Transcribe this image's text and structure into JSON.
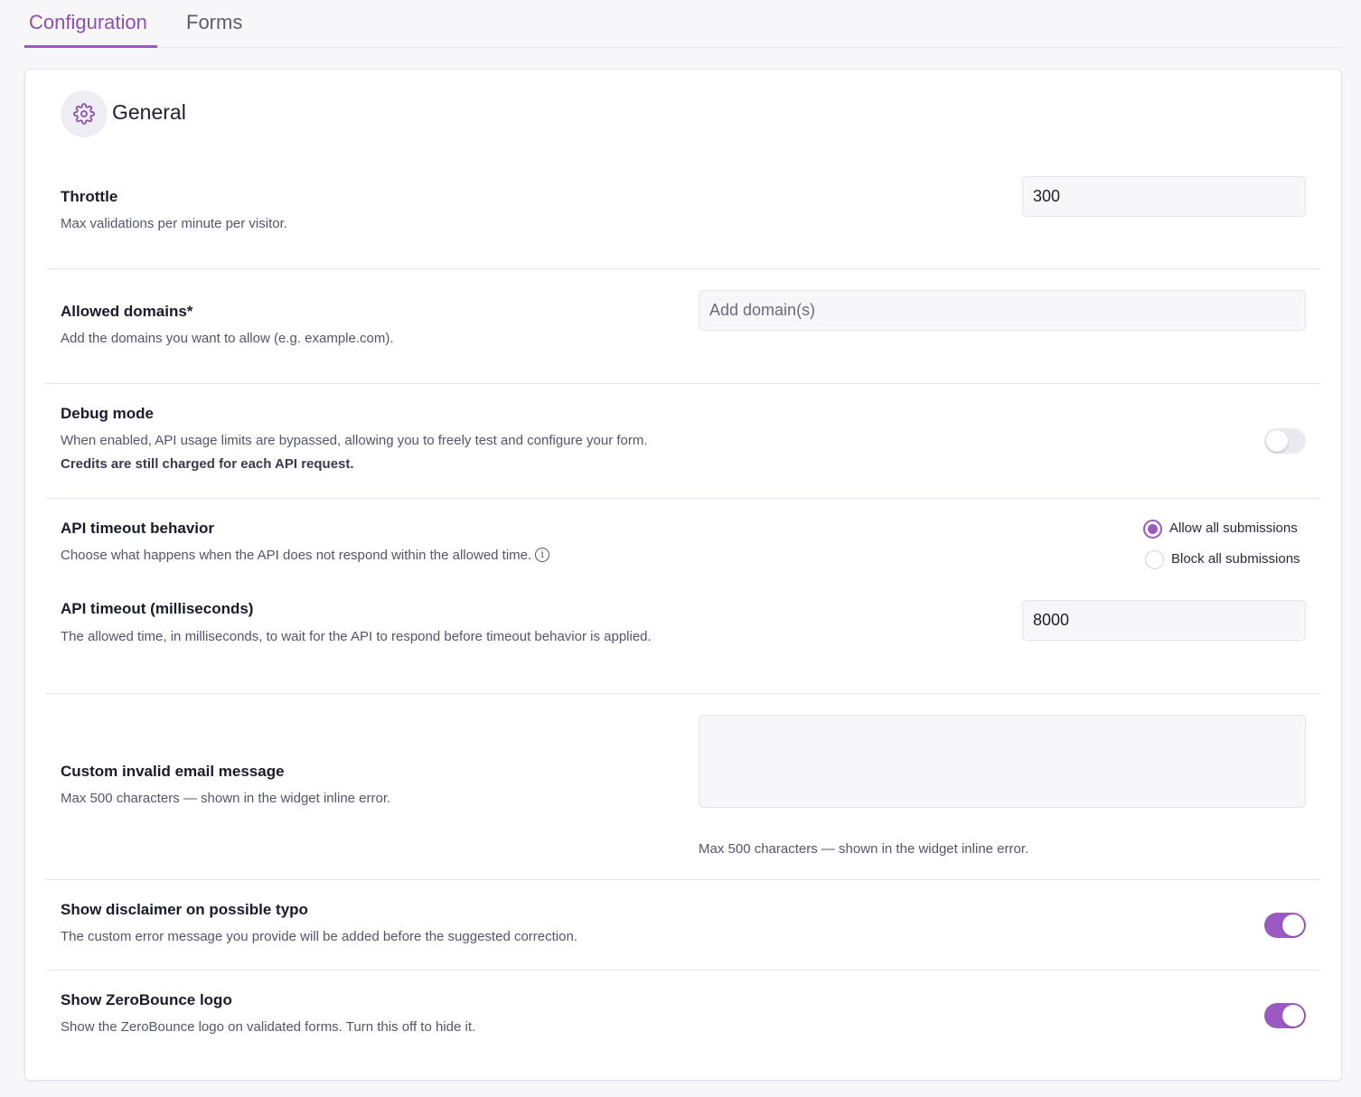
{
  "tabs": [
    {
      "label": "Configuration",
      "active": true
    },
    {
      "label": "Forms",
      "active": false
    }
  ],
  "accent_color": "#9b5ac2",
  "section": {
    "title": "General",
    "icon": "gear-icon"
  },
  "throttle": {
    "label": "Throttle",
    "description": "Max validations per minute per visitor.",
    "value": "300"
  },
  "allowed_domains": {
    "label": "Allowed domains*",
    "description": "Add the domains you want to allow (e.g. example.com).",
    "placeholder": "Add domain(s)",
    "value": ""
  },
  "debug_mode": {
    "label": "Debug mode",
    "description": "When enabled, API usage limits are bypassed, allowing you to freely test and configure your form.",
    "description_bold": "Credits are still charged for each API request.",
    "enabled": false
  },
  "api_timeout_behavior": {
    "label": "API timeout behavior",
    "description": "Choose what happens when the API does not respond within the allowed time.",
    "info_icon": "info-icon",
    "options": [
      {
        "label": "Allow all submissions",
        "selected": true
      },
      {
        "label": "Block all submissions",
        "selected": false
      }
    ]
  },
  "api_timeout": {
    "label": "API timeout (milliseconds)",
    "description": "The allowed time, in milliseconds, to wait for the API to respond before timeout behavior is applied.",
    "value": "8000"
  },
  "custom_message": {
    "label": "Custom invalid email message",
    "description": "Max 500 characters — shown in the widget inline error.",
    "value": "",
    "helper": "Max 500 characters — shown in the widget inline error."
  },
  "show_disclaimer": {
    "label": "Show disclaimer on possible typo",
    "description": "The custom error message you provide will be added before the suggested correction.",
    "enabled": true
  },
  "show_logo": {
    "label": "Show ZeroBounce logo",
    "description": "Show the ZeroBounce logo on validated forms. Turn this off to hide it.",
    "enabled": true
  }
}
